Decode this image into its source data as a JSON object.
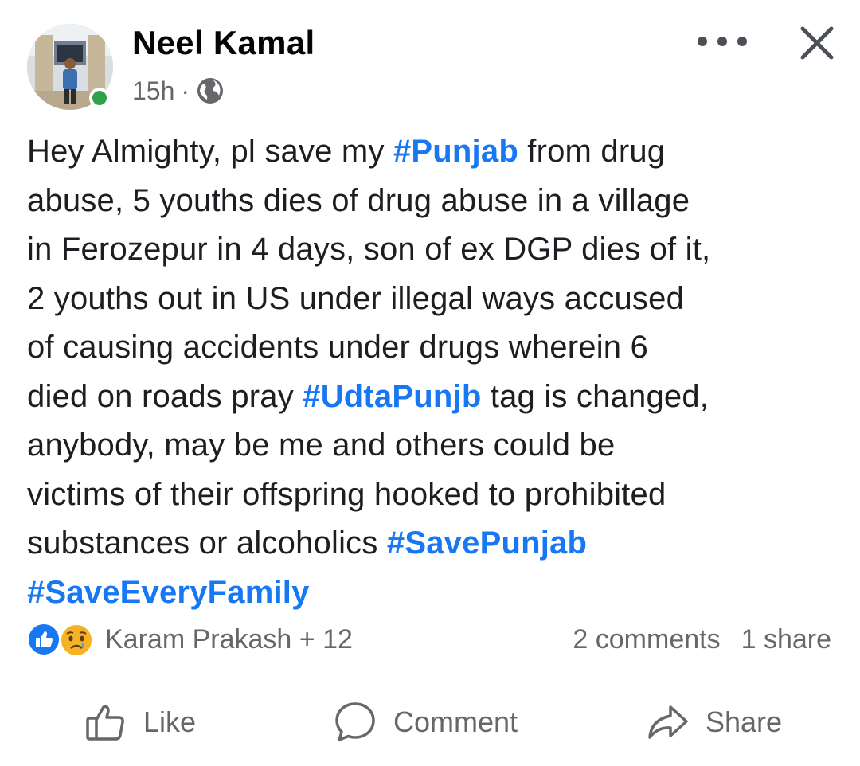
{
  "author": {
    "name": "Neel Kamal",
    "time": "15h",
    "separator": "·",
    "audience_icon": "globe-icon",
    "online_status_color": "#31a24c"
  },
  "header_actions": {
    "more_icon": "more-horizontal-icon",
    "close_icon": "close-icon"
  },
  "post": {
    "lines": [
      [
        {
          "t": "Hey Almighty, pl save my "
        },
        {
          "t": "#Punjab",
          "tag": true
        },
        {
          "t": " from drug"
        }
      ],
      [
        {
          "t": "abuse, 5 youths dies of drug abuse in a village"
        }
      ],
      [
        {
          "t": "in Ferozepur in 4 days, son of ex DGP dies of it,"
        }
      ],
      [
        {
          "t": "2 youths out in US under illegal ways accused"
        }
      ],
      [
        {
          "t": "of causing accidents under drugs wherein 6"
        }
      ],
      [
        {
          "t": "died on roads pray "
        },
        {
          "t": "#UdtaPunjb",
          "tag": true
        },
        {
          "t": " tag is changed,"
        }
      ],
      [
        {
          "t": "anybody, may be me and others could be"
        }
      ],
      [
        {
          "t": "victims of their offspring hooked to prohibited"
        }
      ],
      [
        {
          "t": "substances or alcoholics "
        },
        {
          "t": "#SavePunjab",
          "tag": true
        }
      ],
      [
        {
          "t": "#SaveEveryFamily",
          "tag": true
        }
      ]
    ],
    "hashtag_color": "#1877f2"
  },
  "engagement": {
    "reaction_icons": [
      "like-reaction-icon",
      "sad-reaction-icon"
    ],
    "reactors": "Karam Prakash + 12",
    "comments": "2 comments",
    "shares": "1 share"
  },
  "actions": {
    "like": "Like",
    "comment": "Comment",
    "share": "Share"
  },
  "colors": {
    "text": "#1c1e21",
    "secondary": "#65676b",
    "accent": "#1877f2"
  }
}
